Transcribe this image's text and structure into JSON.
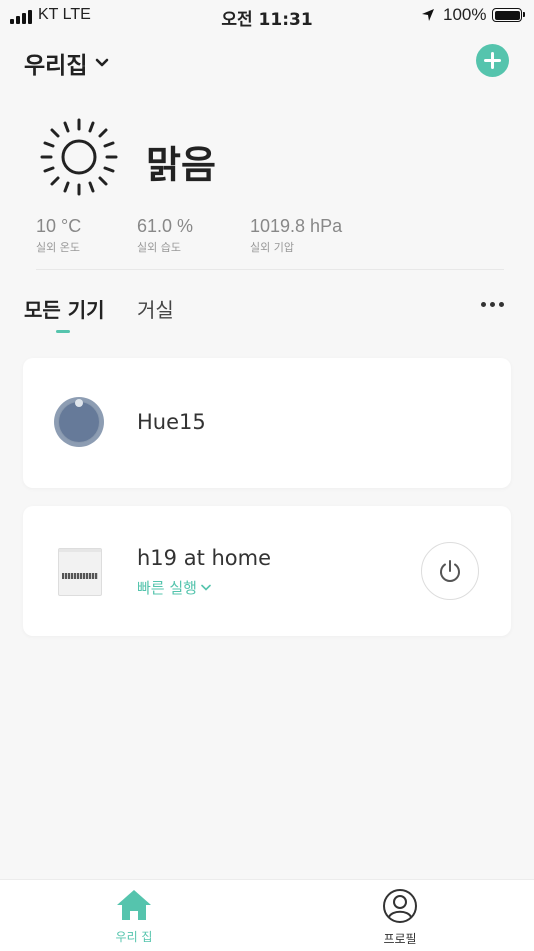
{
  "status_bar": {
    "carrier": "KT  LTE",
    "time": "오전 11:31",
    "battery": "100%"
  },
  "header": {
    "home_name": "우리집"
  },
  "weather": {
    "condition": "맑음",
    "stats": [
      {
        "value": "10 °C",
        "label": "실외 온도"
      },
      {
        "value": "61.0 %",
        "label": "실외 습도"
      },
      {
        "value": "1019.8 hPa",
        "label": "실외 기압"
      }
    ]
  },
  "tabs": [
    {
      "label": "모든 기기",
      "active": true
    },
    {
      "label": "거실",
      "active": false
    }
  ],
  "devices": [
    {
      "name": "Hue15",
      "icon": "robot-vacuum-icon"
    },
    {
      "name": "h19 at home",
      "icon": "air-purifier-icon",
      "quick_action": "빠른 실행"
    }
  ],
  "bottom_nav": [
    {
      "label": "우리 집",
      "icon": "home-icon",
      "active": true
    },
    {
      "label": "프로필",
      "icon": "profile-icon",
      "active": false
    }
  ],
  "colors": {
    "accent": "#55c4ad",
    "background": "#f7f7f7",
    "card": "#ffffff"
  }
}
